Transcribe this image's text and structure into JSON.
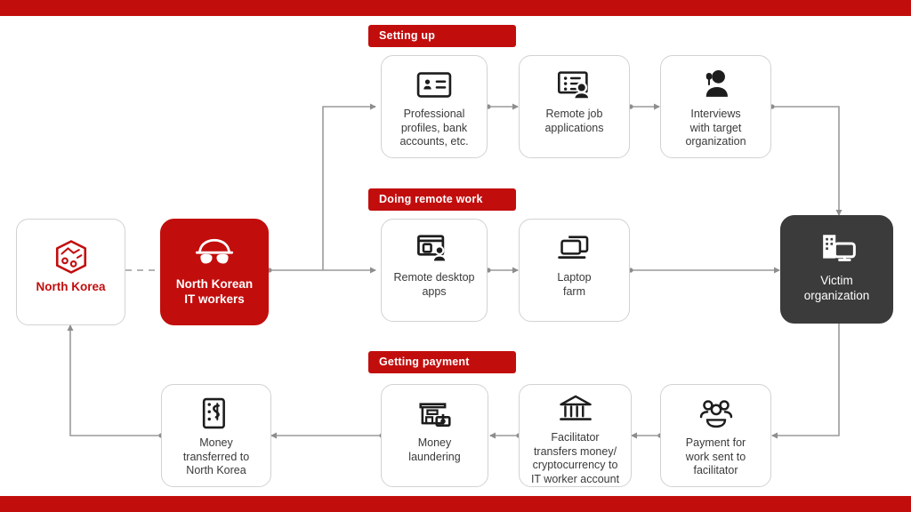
{
  "theme": {
    "accent_red": "#c20d0d",
    "dark": "#3b3b3b",
    "card_border": "#d2d2d2",
    "label_text": "#3a3a3a",
    "connector": "#9a9a9a",
    "page_background": "#ffffff"
  },
  "bars": {
    "top_color": "#c20d0d",
    "bottom_color": "#c20d0d"
  },
  "sections": [
    {
      "id": "setting-up",
      "label": "Setting up"
    },
    {
      "id": "doing-remote-work",
      "label": "Doing remote work"
    },
    {
      "id": "getting-payment",
      "label": "Getting payment"
    }
  ],
  "nodes": {
    "north_korea": {
      "label": "North Korea",
      "icon": "north-korea-map-icon",
      "style": "outline-red-text"
    },
    "it_workers": {
      "label": "North Korean\nIT workers",
      "icon": "masked-spy-icon",
      "style": "filled-red"
    },
    "professional_profiles": {
      "label": "Professional\nprofiles, bank\naccounts, etc.",
      "icon": "id-card-icon",
      "style": "outline"
    },
    "remote_job_applications": {
      "label": "Remote job\napplications",
      "icon": "job-application-list-icon",
      "style": "outline"
    },
    "interviews": {
      "label": "Interviews\nwith target\norganization",
      "icon": "interview-person-microphone-icon",
      "style": "outline"
    },
    "remote_desktop_apps": {
      "label": "Remote desktop\napps",
      "icon": "remote-desktop-window-icon",
      "style": "outline"
    },
    "laptop_farm": {
      "label": "Laptop\nfarm",
      "icon": "stacked-laptops-icon",
      "style": "outline"
    },
    "victim_organization": {
      "label": "Victim\norganization",
      "icon": "office-building-monitor-icon",
      "style": "filled-dark"
    },
    "payment_to_facilitator": {
      "label": "Payment for\nwork sent to\nfacilitator",
      "icon": "group-of-people-icon",
      "style": "outline"
    },
    "facilitator_transfers": {
      "label": "Facilitator\ntransfers money/\ncryptocurrency to\nIT worker account",
      "icon": "bank-building-icon",
      "style": "outline"
    },
    "money_laundering": {
      "label": "Money\nlaundering",
      "icon": "storefront-cash-icon",
      "style": "outline"
    },
    "money_transferred": {
      "label": "Money\ntransferred to\nNorth Korea",
      "icon": "hand-holding-money-tag-icon",
      "style": "outline"
    }
  },
  "flows": [
    {
      "from": "north_korea",
      "to": "it_workers",
      "style": "dashed"
    },
    {
      "from": "it_workers",
      "to": "professional_profiles",
      "style": "solid"
    },
    {
      "from": "it_workers",
      "to": "remote_desktop_apps",
      "style": "solid"
    },
    {
      "from": "professional_profiles",
      "to": "remote_job_applications",
      "style": "solid"
    },
    {
      "from": "remote_job_applications",
      "to": "interviews",
      "style": "solid"
    },
    {
      "from": "interviews",
      "to": "victim_organization",
      "style": "solid"
    },
    {
      "from": "remote_desktop_apps",
      "to": "laptop_farm",
      "style": "solid"
    },
    {
      "from": "laptop_farm",
      "to": "victim_organization",
      "style": "solid"
    },
    {
      "from": "victim_organization",
      "to": "payment_to_facilitator",
      "style": "solid"
    },
    {
      "from": "payment_to_facilitator",
      "to": "facilitator_transfers",
      "style": "solid"
    },
    {
      "from": "facilitator_transfers",
      "to": "money_laundering",
      "style": "solid"
    },
    {
      "from": "money_laundering",
      "to": "money_transferred",
      "style": "solid"
    },
    {
      "from": "money_transferred",
      "to": "north_korea",
      "style": "solid"
    }
  ]
}
